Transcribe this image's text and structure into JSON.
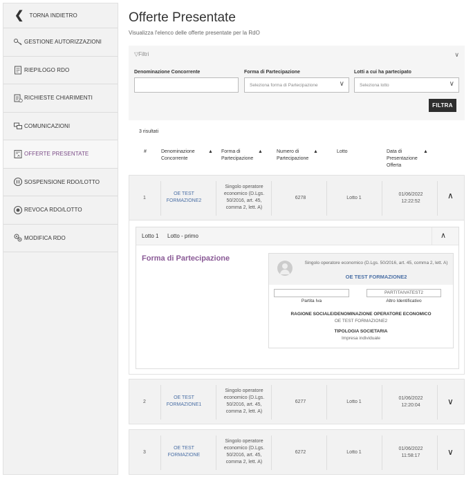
{
  "sidebar": {
    "back_label": "TORNA INDIETRO",
    "items": [
      {
        "label": "GESTIONE AUTORIZZAZIONI",
        "icon": "keys-icon"
      },
      {
        "label": "RIEPILOGO RDO",
        "icon": "clipboard-icon"
      },
      {
        "label": "RICHIESTE CHIARIMENTI",
        "icon": "document-question-icon"
      },
      {
        "label": "COMUNICAZIONI",
        "icon": "messages-icon"
      },
      {
        "label": "OFFERTE PRESENTATE",
        "icon": "offer-document-icon"
      },
      {
        "label": "SOSPENSIONE RDO/LOTTO",
        "icon": "pause-icon"
      },
      {
        "label": "REVOCA RDO/LOTTO",
        "icon": "revoke-icon"
      },
      {
        "label": "MODIFICA RDO",
        "icon": "gears-icon"
      }
    ],
    "active_color": "#7a4a86"
  },
  "page": {
    "title": "Offerte Presentate",
    "subtitle": "Visualizza l'elenco delle offerte presentate per la RdO"
  },
  "filter": {
    "title": "Filtri",
    "denominazione_label": "Denominazione Concorrente",
    "denominazione_value": "",
    "forma_label": "Forma di Partecipazione",
    "forma_placeholder": "Seleziona forma di Partecipazione",
    "lotti_label": "Lotti a cui ha partecipato",
    "lotti_placeholder": "Seleziona lotto",
    "button_label": "FILTRA"
  },
  "results": {
    "count_label": "3 risultati",
    "headers": {
      "num": "#",
      "denominazione": "Denominazione Concorrente",
      "forma": "Forma di Partecipazione",
      "numero": "Numero di Partecipazione",
      "lotto": "Lotto",
      "data": "Data di Presentazione Offerta"
    },
    "rows": [
      {
        "num": "1",
        "denominazione": "OE TEST FORMAZIONE2",
        "forma": "Singolo operatore economico (D.Lgs. 50/2016, art. 45, comma 2, lett. A)",
        "numero": "6278",
        "lotto": "Lotto 1",
        "data": "01/06/2022",
        "ora": "12:22:52",
        "expanded": true
      },
      {
        "num": "2",
        "denominazione": "OE TEST FORMAZIONE1",
        "forma": "Singolo operatore economico (D.Lgs. 50/2016, art. 45, comma 2, lett. A)",
        "numero": "6277",
        "lotto": "Lotto 1",
        "data": "01/06/2022",
        "ora": "12:20:04",
        "expanded": false
      },
      {
        "num": "3",
        "denominazione": "OE TEST FORMAZIONE",
        "forma": "Singolo operatore economico (D.Lgs. 50/2016, art. 45, comma 2, lett. A)",
        "numero": "6272",
        "lotto": "Lotto 1",
        "data": "01/06/2022",
        "ora": "11:58:17",
        "expanded": false
      }
    ]
  },
  "detail": {
    "lotto_label": "Lotto 1",
    "lotto_name": "Lotto - primo",
    "section_title": "Forma di Partecipazione",
    "card": {
      "desc": "Singolo operatore economico (D.Lgs. 50/2016, art. 45, comma 2, lett. A)",
      "name": "OE TEST FORMAZIONE2",
      "partita_iva_value": "",
      "partita_iva_label": "Partita Iva",
      "altro_value": "PARTITAIVATEST2",
      "altro_label": "Altro Identificativo",
      "ragione_label": "RAGIONE SOCIALE/DENOMINAZIONE OPERATORE ECONOMICO",
      "ragione_value": "OE TEST FORMAZIONE2",
      "tipologia_label": "TIPOLOGIA SOCIETARIA",
      "tipologia_value": "Impresa individuale"
    }
  }
}
